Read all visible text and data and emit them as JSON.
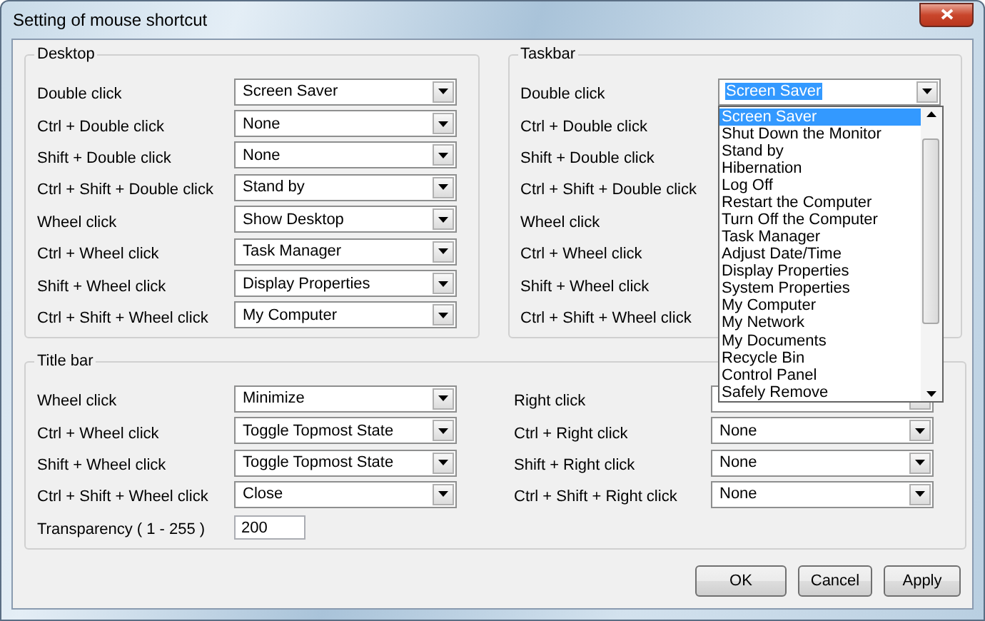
{
  "window": {
    "title": "Setting of mouse shortcut"
  },
  "desktop": {
    "title": "Desktop",
    "rows": [
      {
        "label": "Double click",
        "value": "Screen Saver"
      },
      {
        "label": "Ctrl + Double click",
        "value": "None"
      },
      {
        "label": "Shift + Double click",
        "value": "None"
      },
      {
        "label": "Ctrl + Shift + Double click",
        "value": "Stand by"
      },
      {
        "label": "Wheel click",
        "value": "Show Desktop"
      },
      {
        "label": "Ctrl + Wheel click",
        "value": "Task Manager"
      },
      {
        "label": "Shift + Wheel click",
        "value": "Display Properties"
      },
      {
        "label": "Ctrl + Shift + Wheel click",
        "value": "My Computer"
      }
    ]
  },
  "taskbar": {
    "title": "Taskbar",
    "rows": [
      {
        "label": "Double click",
        "value": "Screen Saver",
        "open": true
      },
      {
        "label": "Ctrl + Double click"
      },
      {
        "label": "Shift + Double click"
      },
      {
        "label": "Ctrl + Shift + Double click"
      },
      {
        "label": "Wheel click"
      },
      {
        "label": "Ctrl + Wheel click"
      },
      {
        "label": "Shift + Wheel click"
      },
      {
        "label": "Ctrl + Shift + Wheel click"
      }
    ],
    "dropdown": {
      "items": [
        {
          "label": "Screen Saver",
          "selected": true
        },
        {
          "label": "Shut Down the Monitor",
          "selected": false
        },
        {
          "label": "Stand by",
          "selected": false
        },
        {
          "label": "Hibernation",
          "selected": false
        },
        {
          "label": "Log Off",
          "selected": false
        },
        {
          "label": "Restart the Computer",
          "selected": false
        },
        {
          "label": "Turn Off the Computer",
          "selected": false
        },
        {
          "label": "Task Manager",
          "selected": false
        },
        {
          "label": "Adjust Date/Time",
          "selected": false
        },
        {
          "label": "Display Properties",
          "selected": false
        },
        {
          "label": "System Properties",
          "selected": false
        },
        {
          "label": "My Computer",
          "selected": false
        },
        {
          "label": "My Network",
          "selected": false
        },
        {
          "label": "My Documents",
          "selected": false
        },
        {
          "label": "Recycle Bin",
          "selected": false
        },
        {
          "label": "Control Panel",
          "selected": false
        },
        {
          "label": "Safely Remove",
          "selected": false
        }
      ]
    }
  },
  "title_bar": {
    "title": "Title bar",
    "left_rows": [
      {
        "label": "Wheel click",
        "value": "Minimize"
      },
      {
        "label": "Ctrl + Wheel click",
        "value": "Toggle Topmost State"
      },
      {
        "label": "Shift + Wheel click",
        "value": "Toggle Topmost State"
      },
      {
        "label": "Ctrl + Shift + Wheel click",
        "value": "Close"
      }
    ],
    "right_rows": [
      {
        "label": "Right click"
      },
      {
        "label": "Ctrl + Right click",
        "value": "None"
      },
      {
        "label": "Shift + Right click",
        "value": "None"
      },
      {
        "label": "Ctrl + Shift + Right click",
        "value": "None"
      }
    ],
    "transparency": {
      "label": "Transparency ( 1 - 255 )",
      "value": "200"
    }
  },
  "buttons": [
    "OK",
    "Cancel",
    "Apply"
  ]
}
